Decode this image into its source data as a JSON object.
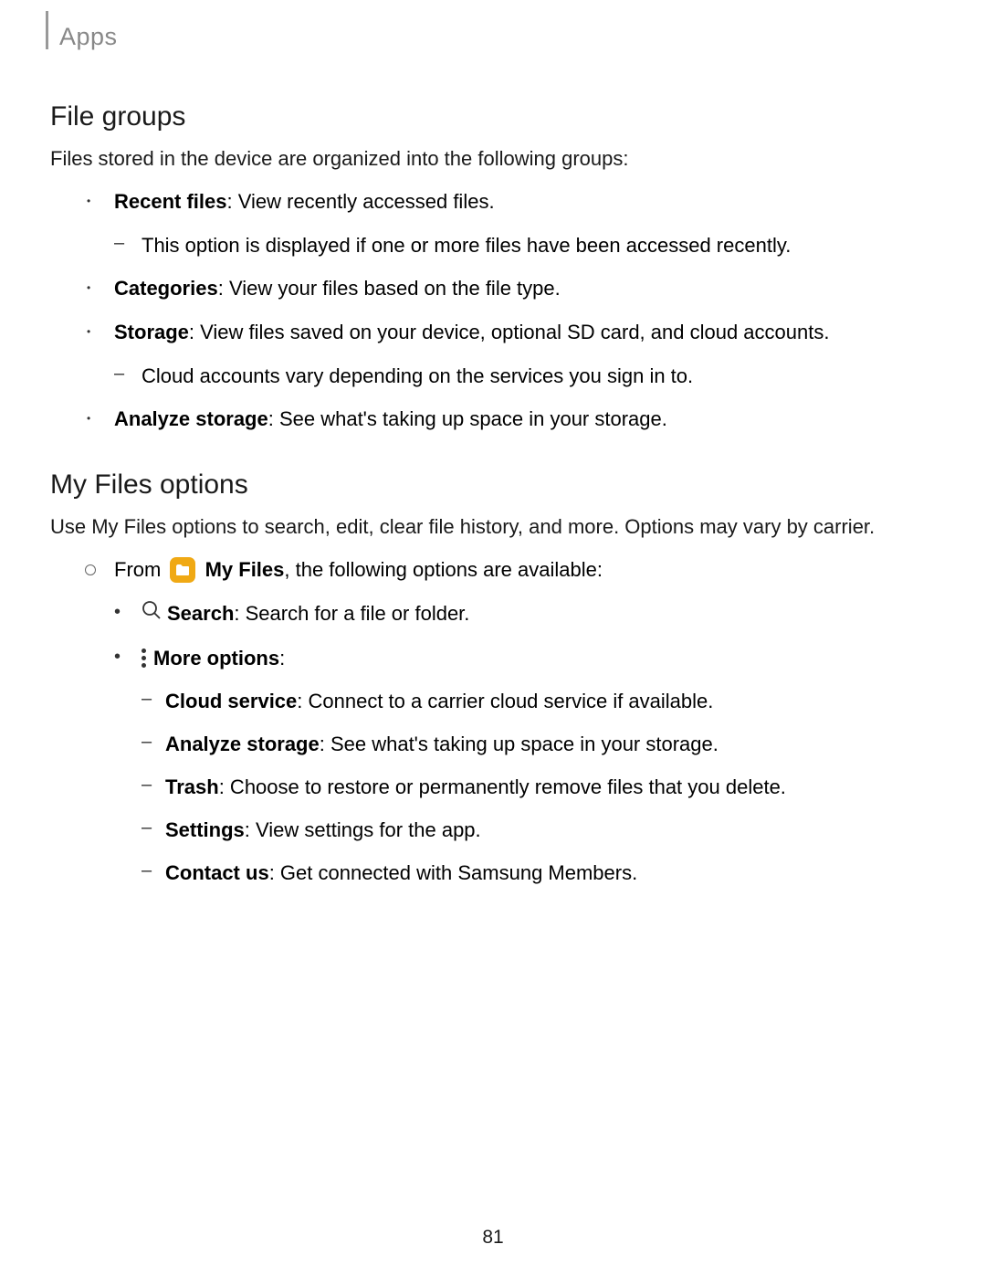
{
  "header": {
    "section": "Apps"
  },
  "section1": {
    "heading": "File groups",
    "intro": "Files stored in the device are organized into the following groups:",
    "items": [
      {
        "label": "Recent files",
        "desc": ": View recently accessed files.",
        "sub": [
          "This option is displayed if one or more files have been accessed recently."
        ]
      },
      {
        "label": "Categories",
        "desc": ": View your files based on the file type."
      },
      {
        "label": "Storage",
        "desc": ": View files saved on your device, optional SD card, and cloud accounts.",
        "sub": [
          "Cloud accounts vary depending on the services you sign in to."
        ]
      },
      {
        "label": "Analyze storage",
        "desc": ": See what's taking up space in your storage."
      }
    ]
  },
  "section2": {
    "heading": "My Files options",
    "intro": "Use My Files options to search, edit, clear file history, and more. Options may vary by carrier.",
    "fromPrefix": "From ",
    "fromApp": "My Files",
    "fromSuffix": ", the following options are available:",
    "options": [
      {
        "icon": "search",
        "label": "Search",
        "desc": ": Search for a file or folder."
      },
      {
        "icon": "more",
        "label": "More options",
        "desc": ":",
        "sub": [
          {
            "label": "Cloud service",
            "desc": ": Connect to a carrier cloud service if available."
          },
          {
            "label": "Analyze storage",
            "desc": ": See what's taking up space in your storage."
          },
          {
            "label": "Trash",
            "desc": ": Choose to restore or permanently remove files that you delete."
          },
          {
            "label": "Settings",
            "desc": ": View settings for the app."
          },
          {
            "label": "Contact us",
            "desc": ": Get connected with Samsung Members."
          }
        ]
      }
    ]
  },
  "pageNumber": "81"
}
